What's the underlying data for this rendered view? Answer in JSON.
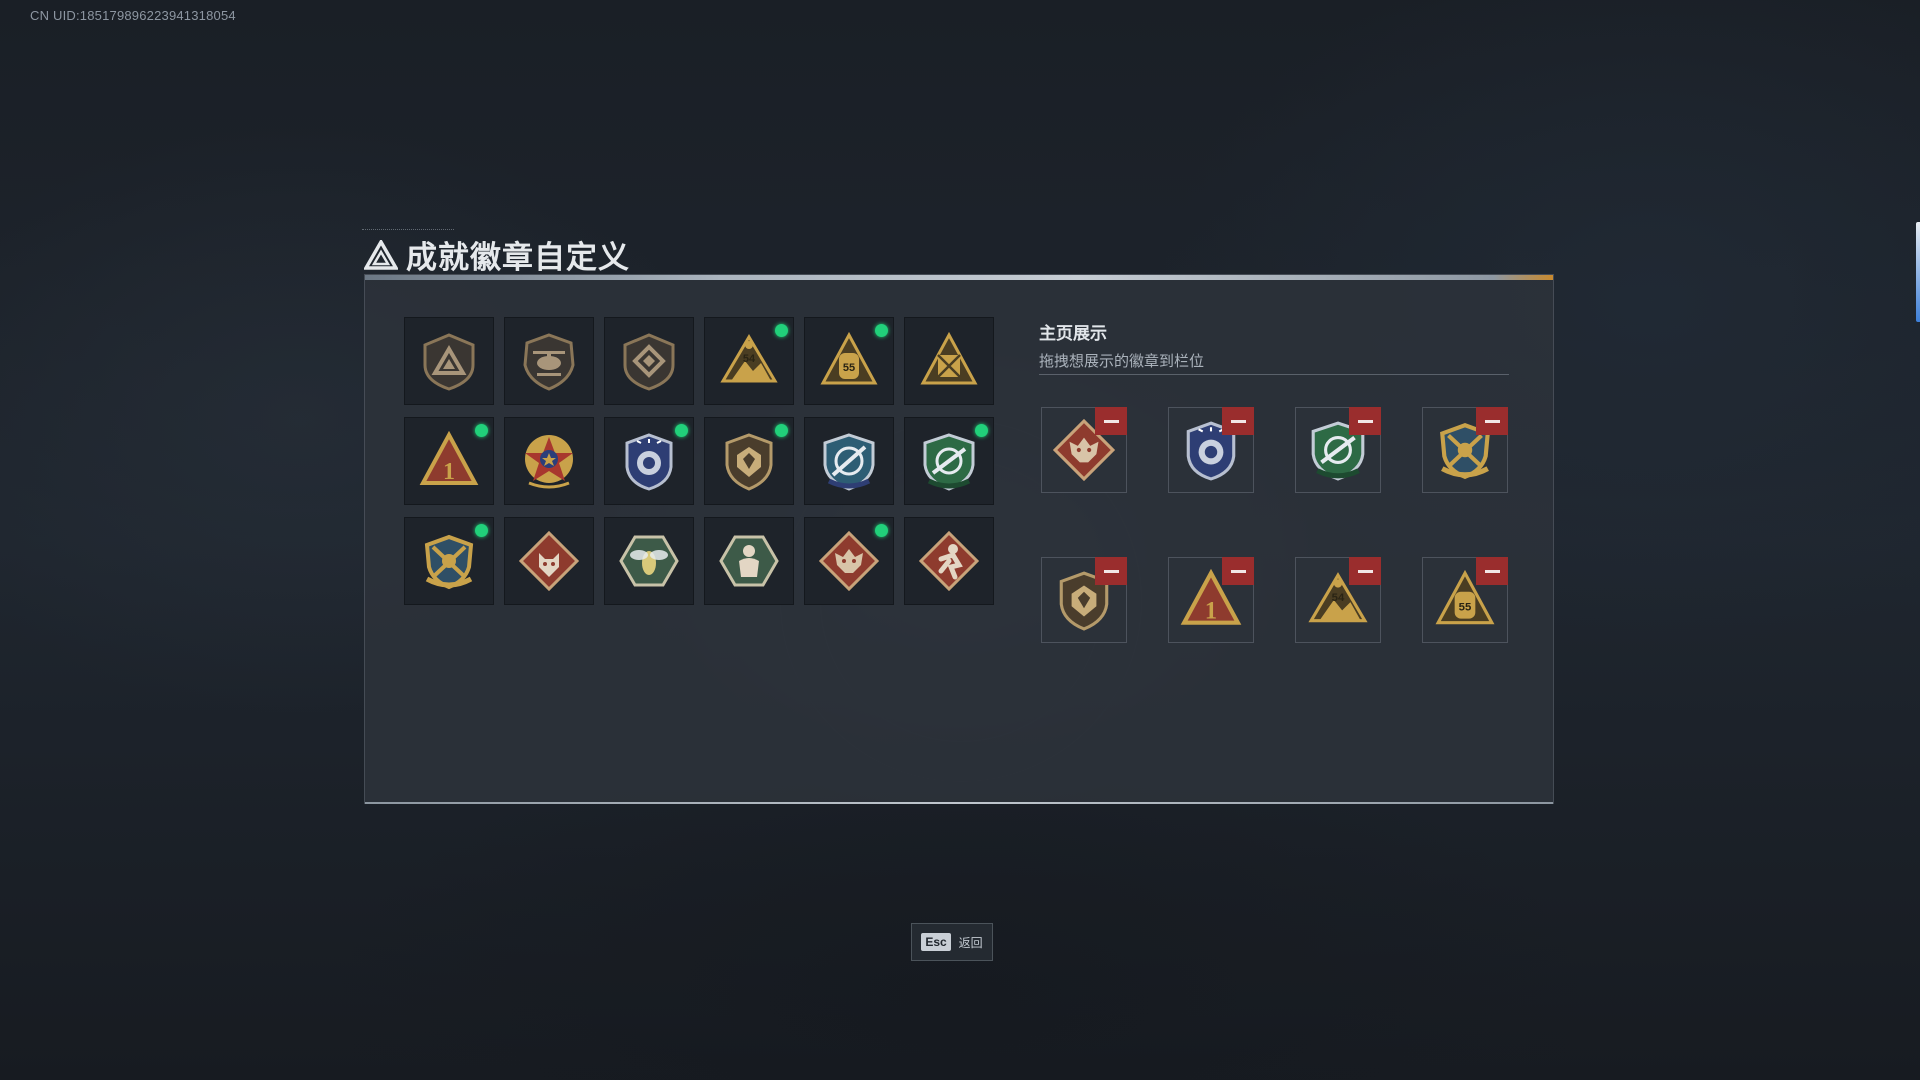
{
  "uid": "CN UID:1851798962239413180​54",
  "title": "成就徽章自定义",
  "showcase": {
    "title": "主页展示",
    "subtitle": "拖拽想展示的徽章到栏位"
  },
  "esc": {
    "key": "Esc",
    "label": "返回"
  },
  "colors": {
    "new_dot": "#21d07a",
    "remove": "#9a2d2d",
    "gold": "#c9a24a",
    "bronze": "#8a7658",
    "red": "#8e3b2e",
    "navy": "#2e3e74",
    "green": "#2d6a45"
  },
  "badges": [
    {
      "icon": "triangle-shield-badge-icon",
      "new": false
    },
    {
      "icon": "helicopter-badge-icon",
      "new": false
    },
    {
      "icon": "diamond-shield-badge-icon",
      "new": false
    },
    {
      "icon": "gold-54-mountain-badge-icon",
      "new": true
    },
    {
      "icon": "gold-55-bag-badge-icon",
      "new": true
    },
    {
      "icon": "gold-crate-badge-icon",
      "new": false
    },
    {
      "icon": "rank-1-triangle-badge-icon",
      "new": true
    },
    {
      "icon": "red-gold-star-wreath-badge-icon",
      "new": false
    },
    {
      "icon": "blue-police-shield-badge-icon",
      "new": true
    },
    {
      "icon": "bronze-armor-shield-badge-icon",
      "new": true
    },
    {
      "icon": "blue-sniper-shield-badge-icon",
      "new": false
    },
    {
      "icon": "green-rifle-shield-badge-icon",
      "new": true
    },
    {
      "icon": "gold-crossed-rifles-badge-icon",
      "new": true
    },
    {
      "icon": "wolf-diamond-badge-icon",
      "new": false
    },
    {
      "icon": "hornet-hexagon-badge-icon",
      "new": false
    },
    {
      "icon": "soldier-hexagon-badge-icon",
      "new": false
    },
    {
      "icon": "dragon-diamond-badge-icon",
      "new": true
    },
    {
      "icon": "runner-diamond-badge-icon",
      "new": false
    }
  ],
  "showcase_slots": [
    {
      "icon": "dragon-diamond-badge-icon"
    },
    {
      "icon": "blue-police-shield-badge-icon"
    },
    {
      "icon": "green-rifle-shield-badge-icon"
    },
    {
      "icon": "gold-crossed-rifles-badge-icon"
    },
    {
      "icon": "bronze-armor-shield-badge-icon"
    },
    {
      "icon": "rank-1-triangle-badge-icon"
    },
    {
      "icon": "gold-54-mountain-badge-icon"
    },
    {
      "icon": "gold-55-bag-badge-icon"
    }
  ]
}
